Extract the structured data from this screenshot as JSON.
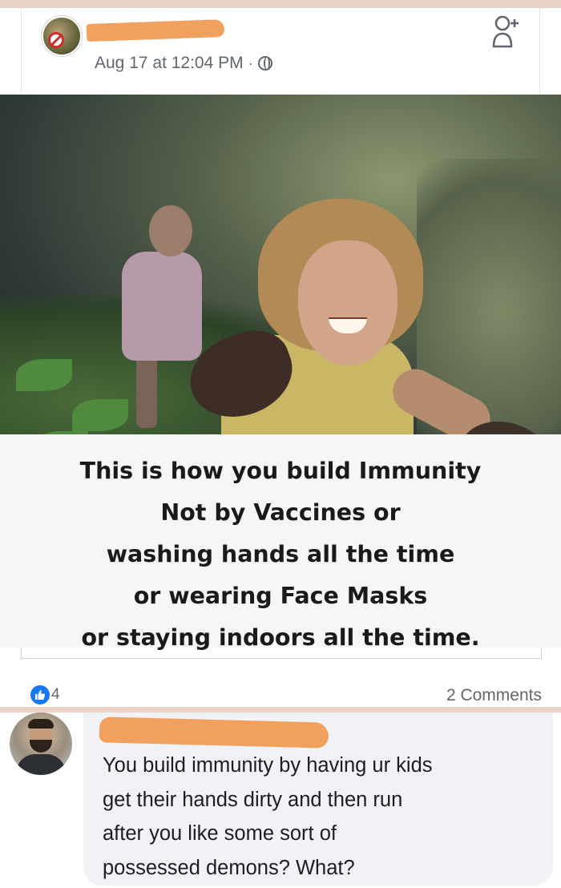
{
  "post": {
    "timestamp": "Aug 17 at 12:04 PM",
    "separator": "·",
    "privacy_icon": "globe-icon",
    "action_icon": "add-friend-icon"
  },
  "photo": {
    "caption_lines": [
      "This is how you build Immunity",
      "Not by Vaccines or",
      "washing hands all the time",
      "or wearing Face Masks",
      "or staying indoors all the time."
    ]
  },
  "reactions": {
    "like_icon": "like-icon",
    "like_count": "4",
    "comments_label": "2 Comments"
  },
  "comment": {
    "text_lines": [
      "You build immunity by having ur kids",
      "get their hands dirty and then run",
      "after you like some sort of",
      "possessed demons? What?"
    ]
  },
  "colors": {
    "facebook_blue": "#1877f2",
    "redaction_orange": "#f2a05d",
    "secondary_text": "#606770",
    "bubble_bg": "#f0f2f5"
  }
}
